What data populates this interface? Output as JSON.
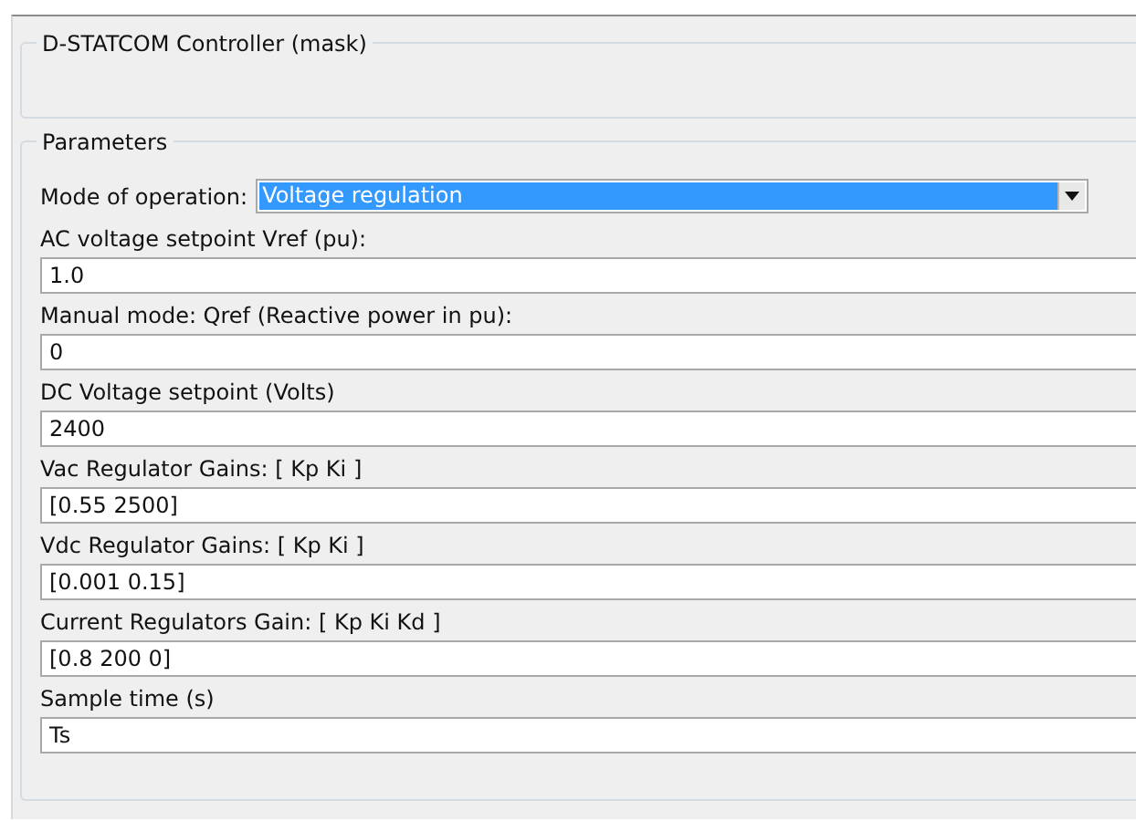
{
  "description": {
    "title": "D-STATCOM Controller (mask)"
  },
  "parameters": {
    "title": "Parameters",
    "mode": {
      "label": "Mode of operation:",
      "value": "Voltage regulation",
      "focused": true
    },
    "fields": [
      {
        "label": "AC voltage setpoint Vref (pu):",
        "value": "1.0"
      },
      {
        "label": "Manual mode: Qref (Reactive power in pu):",
        "value": "0"
      },
      {
        "label": "DC Voltage setpoint (Volts)",
        "value": "2400"
      },
      {
        "label": "Vac Regulator Gains: [ Kp  Ki ]",
        "value": "[0.55 2500]"
      },
      {
        "label": "Vdc Regulator Gains: [ Kp  Ki ]",
        "value": "[0.001 0.15]"
      },
      {
        "label": "Current Regulators Gain: [ Kp Ki Kd ]",
        "value": "[0.8 200 0]"
      },
      {
        "label": "Sample time (s)",
        "value": "Ts"
      }
    ]
  }
}
